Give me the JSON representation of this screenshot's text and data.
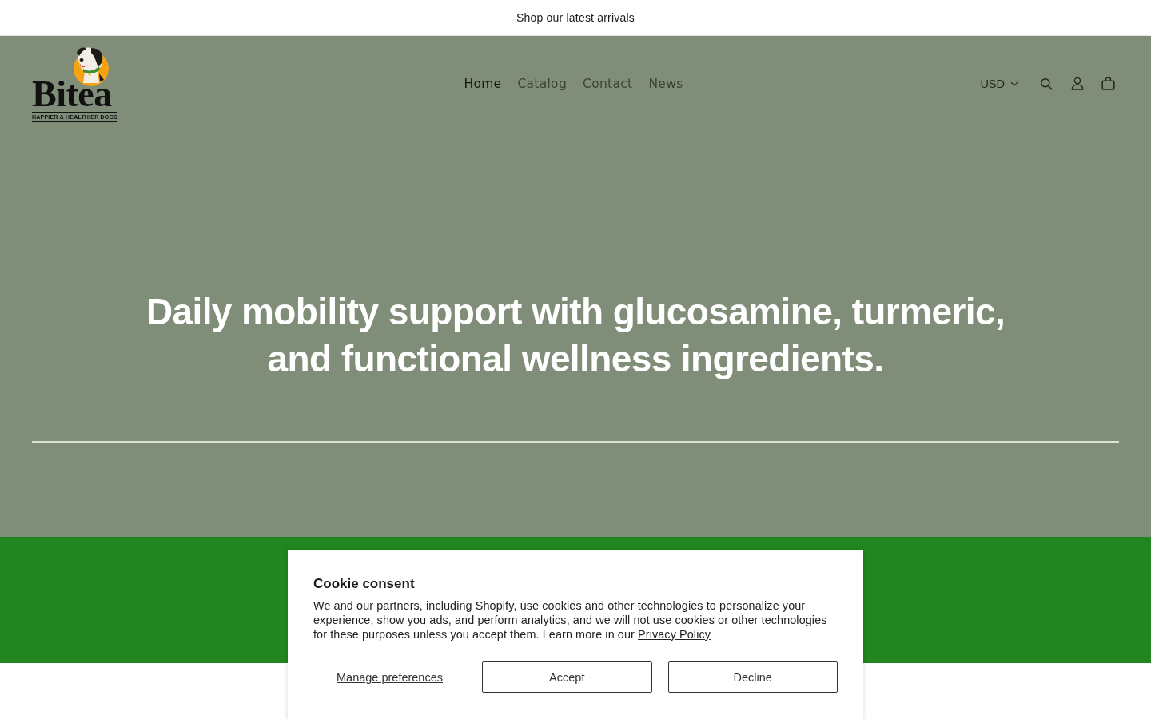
{
  "announcement_bar": {
    "text": "Shop our latest arrivals"
  },
  "header": {
    "logo": {
      "name": "Bitea",
      "tagline": "HAPPIER & HEALTHIER DOGS"
    },
    "nav": [
      {
        "label": "Home",
        "selected": true
      },
      {
        "label": "Catalog",
        "selected": false
      },
      {
        "label": "Contact",
        "selected": false
      },
      {
        "label": "News",
        "selected": false
      }
    ],
    "currency": {
      "label": "USD"
    }
  },
  "hero": {
    "heading": "Daily mobility support with glucosamine, turmeric, and functional wellness ingredients."
  },
  "cookie_consent": {
    "title": "Cookie consent",
    "body": "We and our partners, including Shopify, use cookies and other technologies to personalize your experience, show you ads, and perform analytics, and we will not use cookies or other technologies for these purposes unless you accept them. Learn more in our",
    "link": "Privacy Policy",
    "buttons": [
      {
        "label": "Manage preferences",
        "kind": "link"
      },
      {
        "label": "Accept",
        "kind": "outline"
      },
      {
        "label": "Decline",
        "kind": "outline"
      }
    ]
  }
}
